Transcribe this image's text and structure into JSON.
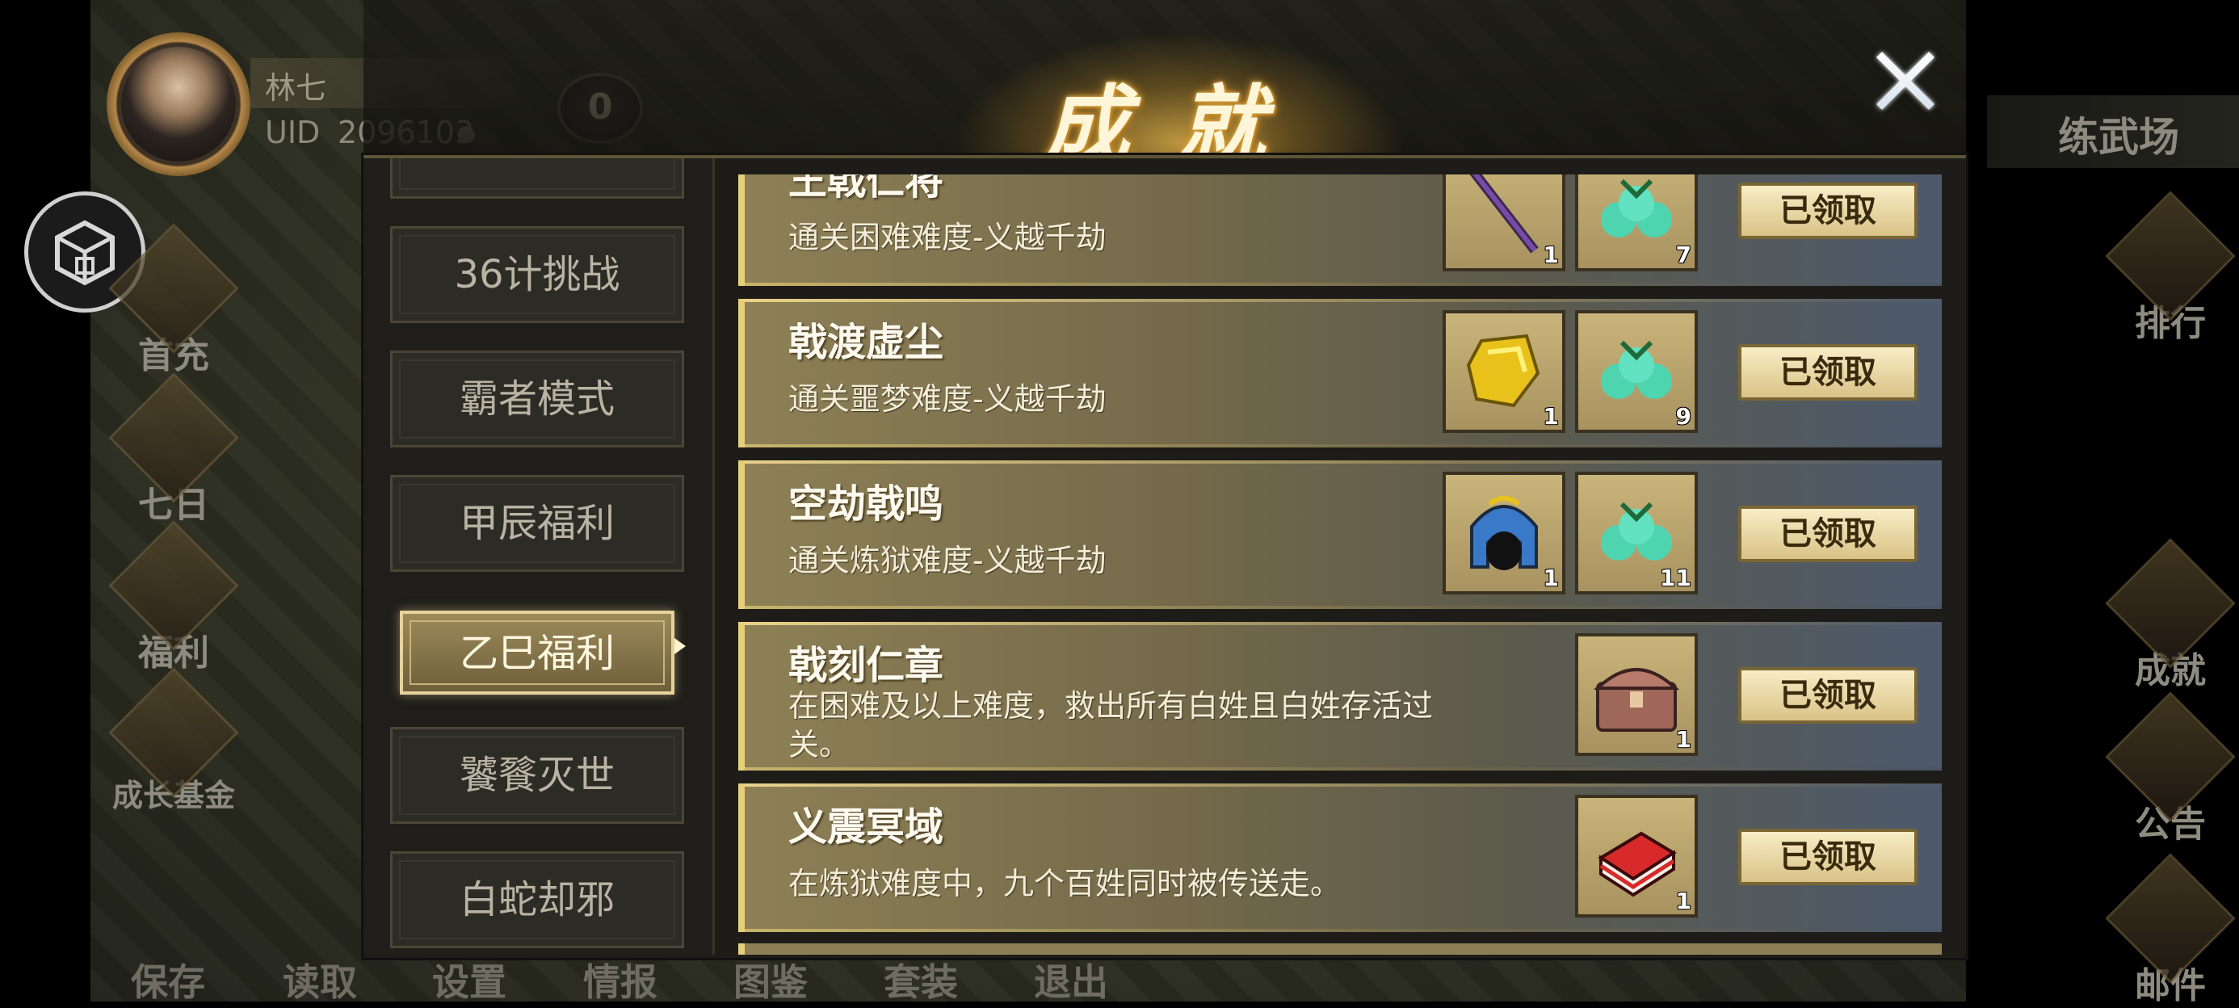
{
  "player": {
    "name": "林七",
    "uid_label": "UID",
    "uid_value": "2096103",
    "rank": "0"
  },
  "side_left": [
    "首充",
    "七日",
    "福利",
    "成长基金"
  ],
  "side_right": {
    "top": "练武场",
    "items": [
      "排行",
      "成就",
      "公告",
      "邮件"
    ]
  },
  "bottom_bar": [
    "保存",
    "读取",
    "设置",
    "情报",
    "图鉴",
    "套装",
    "退出"
  ],
  "modal": {
    "title": "成就"
  },
  "nav": {
    "items": [
      {
        "label": "36计挑战"
      },
      {
        "label": "霸者模式"
      },
      {
        "label": "甲辰福利"
      },
      {
        "label": "乙巳福利",
        "active": true
      },
      {
        "label": "饕餮灭世"
      },
      {
        "label": "白蛇却邪"
      }
    ]
  },
  "achievements": [
    {
      "title": "王戟仁将",
      "desc": "通关困难难度-义越千劫",
      "rewards": [
        {
          "icon": "halberd-icon",
          "qty": "1"
        },
        {
          "icon": "jade-gem-icon",
          "qty": "7"
        }
      ],
      "button": "已领取"
    },
    {
      "title": "戟渡虚尘",
      "desc": "通关噩梦难度-义越千劫",
      "rewards": [
        {
          "icon": "gold-ingot-icon",
          "qty": "1"
        },
        {
          "icon": "jade-gem-icon",
          "qty": "9"
        }
      ],
      "button": "已领取"
    },
    {
      "title": "空劫戟鸣",
      "desc": "通关炼狱难度-义越千劫",
      "rewards": [
        {
          "icon": "helmet-icon",
          "qty": "1"
        },
        {
          "icon": "jade-gem-icon",
          "qty": "11"
        }
      ],
      "button": "已领取"
    },
    {
      "title": "戟刻仁章",
      "desc": "在困难及以上难度，救出所有白姓且白姓存活过关。",
      "rewards": [
        {
          "icon": "chest-icon",
          "qty": "1"
        }
      ],
      "button": "已领取"
    },
    {
      "title": "义震冥域",
      "desc": "在炼狱难度中，九个百姓同时被传送走。",
      "rewards": [
        {
          "icon": "book-icon",
          "qty": "1"
        }
      ],
      "button": "已领取"
    }
  ],
  "colors": {
    "accent_gold": "#e7cf7a",
    "button_bg": "#f1e2b0",
    "title_glow": "#d89a30"
  }
}
